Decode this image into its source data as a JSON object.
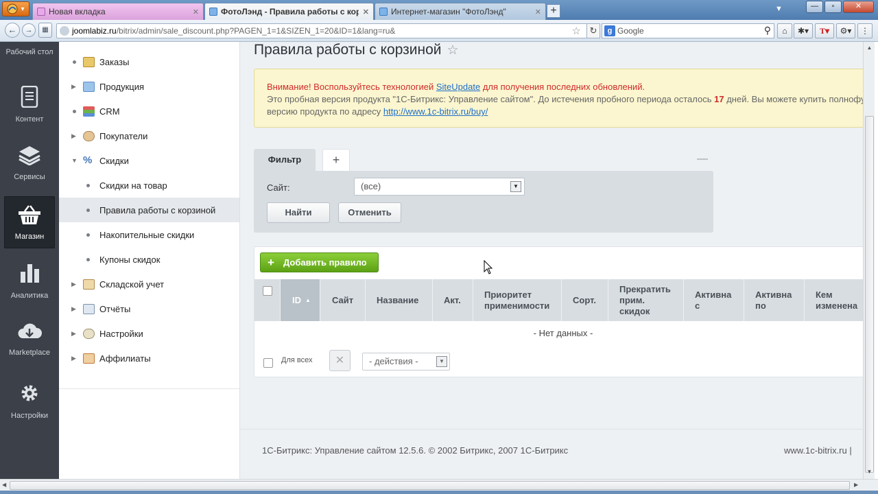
{
  "browser": {
    "firefox_label": "ff",
    "tabs": [
      {
        "title": "Новая вкладка",
        "active": false
      },
      {
        "title": "ФотоЛэнд - Правила работы с корз...",
        "active": true
      },
      {
        "title": "Интернет-магазин \"ФотоЛэнд\"",
        "active": false
      }
    ],
    "new_tab_label": "+",
    "url_site": "joomlabiz.ru",
    "url_path": "/bitrix/admin/sale_discount.php?PAGEN_1=1&SIZEN_1=20&ID=1&lang=ru&",
    "search_placeholder": "Google"
  },
  "left_panel": {
    "items": [
      {
        "label": "Рабочий стол",
        "icon": "desktop-icon"
      },
      {
        "label": "Контент",
        "icon": "document-icon"
      },
      {
        "label": "Сервисы",
        "icon": "layers-icon"
      },
      {
        "label": "Магазин",
        "icon": "basket-icon",
        "active": true
      },
      {
        "label": "Аналитика",
        "icon": "bar-chart-icon"
      },
      {
        "label": "Marketplace",
        "icon": "cloud-download-icon"
      },
      {
        "label": "Настройки",
        "icon": "gear-icon"
      }
    ]
  },
  "menu": {
    "items": [
      {
        "label": "Заказы",
        "kind": "dot"
      },
      {
        "label": "Продукция",
        "kind": "arrow"
      },
      {
        "label": "CRM",
        "kind": "dot"
      },
      {
        "label": "Покупатели",
        "kind": "arrow"
      },
      {
        "label": "Скидки",
        "kind": "open"
      },
      {
        "label": "Скидки на товар",
        "kind": "sub"
      },
      {
        "label": "Правила работы с корзиной",
        "kind": "sub",
        "selected": true
      },
      {
        "label": "Накопительные скидки",
        "kind": "sub"
      },
      {
        "label": "Купоны скидок",
        "kind": "sub"
      },
      {
        "label": "Складской учет",
        "kind": "arrow"
      },
      {
        "label": "Отчёты",
        "kind": "arrow"
      },
      {
        "label": "Настройки",
        "kind": "arrow"
      },
      {
        "label": "Аффилиаты",
        "kind": "arrow"
      }
    ]
  },
  "page": {
    "title": "Правила работы с корзиной",
    "notice": {
      "line1_red": "Внимание! Воспользуйтесь технологией ",
      "line1_link": "SiteUpdate",
      "line1_rest": " для получения последних обновлений.",
      "line2_a": "Это пробная версия продукта \"1С-Битрикс: Управление сайтом\". До истечения пробного периода осталось ",
      "line2_days": "17",
      "line2_b": " дней. Вы можете купить полнофункциональную",
      "line3_a": "версию продукта по адресу ",
      "line3_link": "http://www.1c-bitrix.ru/buy/"
    },
    "filter": {
      "tab_label": "Фильтр",
      "add_tab": "+",
      "minimize": "—",
      "site_label": "Сайт:",
      "site_value": "(все)",
      "find_button": "Найти",
      "cancel_button": "Отменить"
    },
    "grid": {
      "add_button": "Добавить правило",
      "columns": [
        "ID",
        "Сайт",
        "Название",
        "Акт.",
        "Приоритет применимости",
        "Сорт.",
        "Прекратить прим. скидок",
        "Активна с",
        "Активна по",
        "Кем изменена"
      ],
      "sorted_column": "ID",
      "no_data": "- Нет данных -",
      "for_all": "Для всех",
      "actions_value": "- действия -"
    },
    "footer": {
      "left": "1С-Битрикс: Управление сайтом 12.5.6. © 2002 Битрикс, 2007 1С-Битрикс",
      "right": "www.1c-bitrix.ru  |"
    }
  },
  "colors": {
    "accent_green": "#6cb320",
    "active_panel": "#23272e",
    "notice_bg": "#fbf6cf"
  }
}
